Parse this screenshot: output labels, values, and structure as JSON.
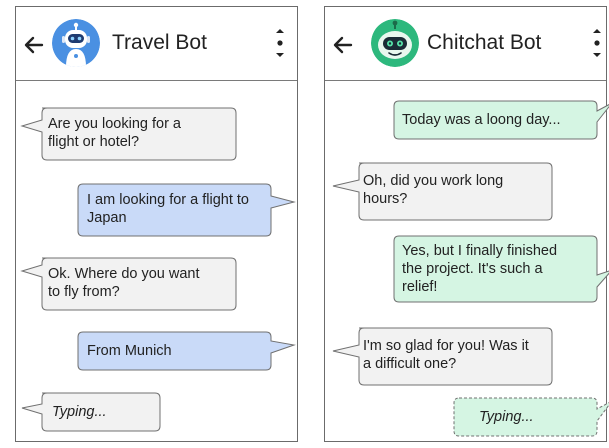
{
  "left_chat": {
    "title": "Travel Bot",
    "messages": [
      {
        "from": "bot",
        "lines": [
          "Are you looking for a",
          "flight or hotel?"
        ]
      },
      {
        "from": "user",
        "lines": [
          "I am looking for a flight to",
          "Japan"
        ]
      },
      {
        "from": "bot",
        "lines": [
          "Ok. Where do you want",
          "to fly from?"
        ]
      },
      {
        "from": "user",
        "lines": [
          "From Munich"
        ]
      },
      {
        "from": "bot",
        "status": "typing",
        "lines": [
          "Typing..."
        ]
      }
    ]
  },
  "right_chat": {
    "title": "Chitchat Bot",
    "messages": [
      {
        "from": "user",
        "lines": [
          "Today was a loong day..."
        ]
      },
      {
        "from": "bot",
        "lines": [
          "Oh, did you work long",
          "hours?"
        ]
      },
      {
        "from": "user",
        "lines": [
          "Yes, but I finally finished",
          "the project. It's such a",
          "relief!"
        ]
      },
      {
        "from": "bot",
        "lines": [
          "I'm so glad for you! Was it",
          "a difficult one?"
        ]
      },
      {
        "from": "user",
        "status": "typing",
        "lines": [
          "Typing..."
        ]
      }
    ]
  },
  "icons": {
    "back": "arrow-left-icon",
    "menu": "vertical-dots-menu-icon",
    "travel_avatar": "robot-avatar",
    "chitchat_avatar": "round-robot-avatar"
  },
  "colors": {
    "bot_bubble": "#f2f2f2",
    "user_bubble_travel": "#c9daf8",
    "user_bubble_chitchat": "#d5f5e3",
    "travel_avatar_bg": "#4a90e2",
    "chitchat_avatar_bg": "#2db87d",
    "border": "#707070"
  }
}
